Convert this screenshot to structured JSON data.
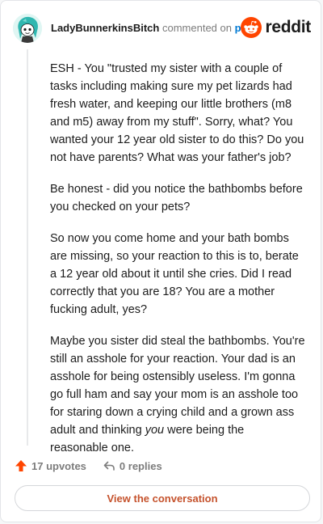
{
  "header": {
    "username": "LadyBunnerkinsBitch",
    "commented_on_text": "commented on",
    "post_link_label": "post",
    "brand_name": "reddit"
  },
  "comment": {
    "paragraphs": [
      {
        "text": "ESH - You \"trusted my sister with a couple of tasks including making sure my pet lizards had fresh water, and keeping our little brothers (m8 and m5) away from my stuff\". Sorry, what? You wanted your 12 year old sister to do this? Do you not have parents? What was your father's job?"
      },
      {
        "text": "Be honest - did you notice the bathbombs before you checked on your pets?"
      },
      {
        "text": "So now you come home and your bath bombs are missing, so your reaction to this is to, berate a 12 year old about it until she cries. Did I read correctly that you are 18? You are a mother fucking adult, yes?"
      },
      {
        "before": "Maybe you sister did steal the bathbombs. You're still an asshole for your reaction. Your dad is an asshole for being ostensibly useless. I'm gonna go full ham and say your mom is an asshole too for staring down a crying child and a grown ass adult and thinking ",
        "emphasis": "you",
        "after": " were being the reasonable one."
      }
    ]
  },
  "actions": {
    "upvotes_label": "17 upvotes",
    "replies_label": "0 replies"
  },
  "view_button_label": "View the conversation",
  "colors": {
    "reddit_orange": "#ff4500",
    "upvote": "#ff4500",
    "link_blue": "#0079d3",
    "button_text": "#c5522c"
  },
  "icons": {
    "avatar": "snoo-avatar-teal-hair",
    "brand": "reddit-alien-logo",
    "upvote": "upvote-arrow-icon",
    "reply": "reply-arrow-icon"
  }
}
